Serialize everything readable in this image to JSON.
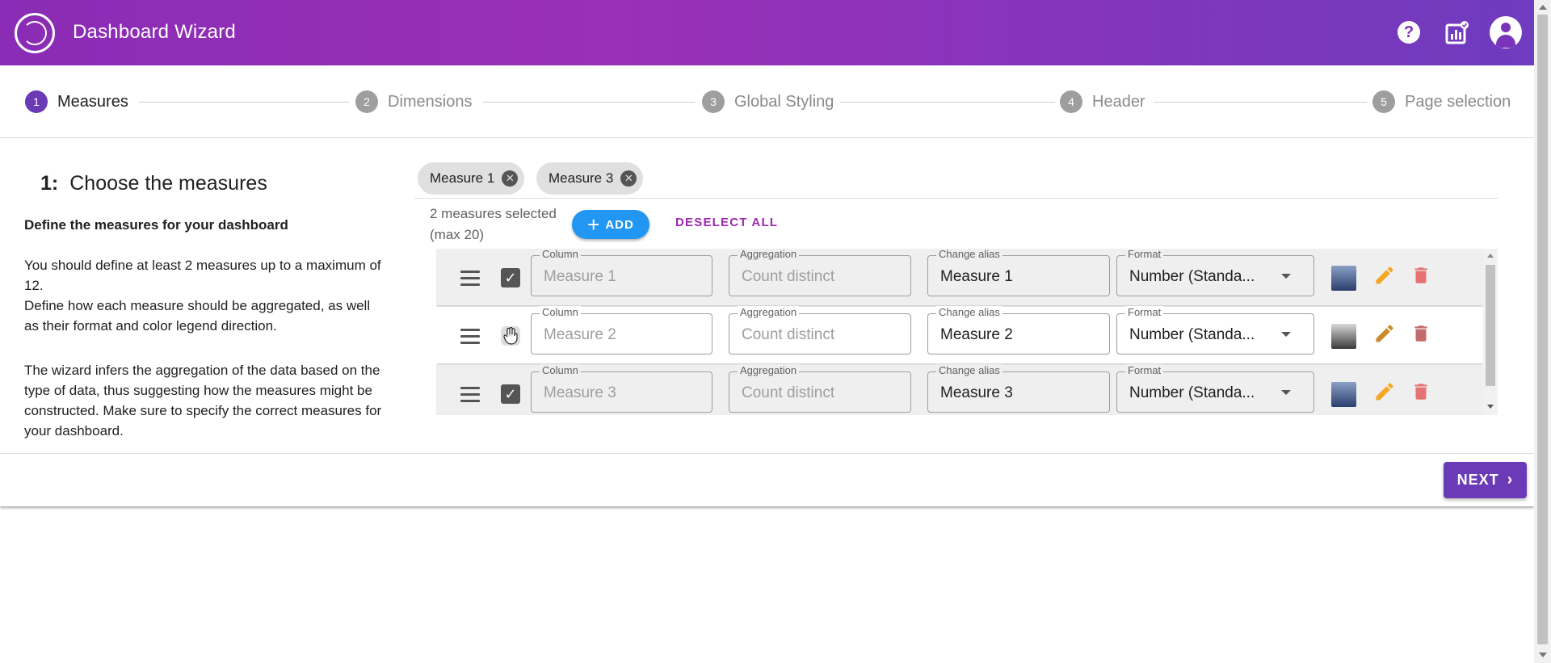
{
  "app": {
    "title": "Dashboard Wizard",
    "brand_gradient": [
      "#8a2cb5",
      "#6f3bbf"
    ]
  },
  "header_icons": {
    "help": "help-icon",
    "report": "chart-check-icon",
    "account": "account-icon"
  },
  "stepper": [
    {
      "num": "1",
      "label": "Measures",
      "active": true
    },
    {
      "num": "2",
      "label": "Dimensions",
      "active": false
    },
    {
      "num": "3",
      "label": "Global Styling",
      "active": false
    },
    {
      "num": "4",
      "label": "Header",
      "active": false
    },
    {
      "num": "5",
      "label": "Page selection",
      "active": false
    }
  ],
  "section": {
    "number": "1:",
    "title": "Choose the measures",
    "subtitle": "Define the measures for your dashboard",
    "paragraph1": "You should define at least 2 measures up to a maximum of 12.\nDefine how each measure should be aggregated, as well as their format and color legend direction.",
    "paragraph2": "The wizard infers the aggregation of the data based on the type of data, thus suggesting how the measures might be constructed. Make sure to specify the correct measures for your dashboard."
  },
  "chips": [
    {
      "label": "Measure 1"
    },
    {
      "label": "Measure 3"
    }
  ],
  "selection": {
    "count_text": "2 measures selected",
    "max_text": "(max 20)",
    "add_label": "ADD",
    "deselect_label": "DESELECT ALL"
  },
  "field_labels": {
    "column": "Column",
    "aggregation": "Aggregation",
    "alias": "Change alias",
    "format": "Format"
  },
  "measures": [
    {
      "checked": true,
      "column": "Measure 1",
      "aggregation": "Count distinct",
      "alias": "Measure 1",
      "format": "Number (Standa...",
      "swatch_colors": [
        "#8aa0c4",
        "#2b3f6e"
      ]
    },
    {
      "checked": false,
      "column": "Measure 2",
      "aggregation": "Count distinct",
      "alias": "Measure 2",
      "format": "Number (Standa...",
      "swatch_colors": [
        "#d8d8d8",
        "#3a3a3a"
      ]
    },
    {
      "checked": true,
      "column": "Measure 3",
      "aggregation": "Count distinct",
      "alias": "Measure 3",
      "format": "Number (Standa...",
      "swatch_colors": [
        "#8aa0c4",
        "#2b3f6e"
      ]
    }
  ],
  "actions": {
    "next_label": "NEXT"
  },
  "colors": {
    "primary": "#6a3ab7",
    "add_blue": "#2196f3",
    "deselect_purple": "#9c27b0",
    "edit_orange": "#f5a623",
    "delete_red": "#e57373"
  }
}
